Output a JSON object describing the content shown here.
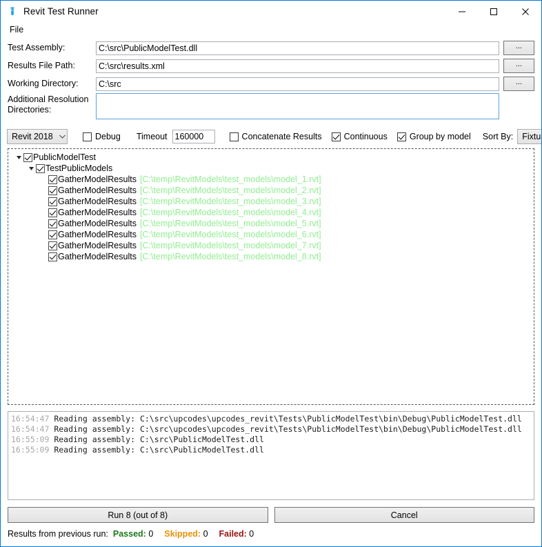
{
  "window": {
    "title": "Revit Test Runner",
    "icon": "test-tube-icon",
    "minimize_label": "Minimize",
    "maximize_label": "Maximize",
    "close_label": "Close",
    "accent_color": "#0078d7"
  },
  "menu": {
    "items": [
      {
        "label": "File"
      }
    ]
  },
  "form": {
    "rows": [
      {
        "label": "Test Assembly:",
        "value": "C:\\src\\PublicModelTest.dll",
        "placeholder": "",
        "browse_label": "...",
        "name": "test-assembly"
      },
      {
        "label": "Results File Path:",
        "value": "C:\\src\\results.xml",
        "placeholder": "",
        "browse_label": "...",
        "name": "results-file-path"
      },
      {
        "label": "Working Directory:",
        "value": "C:\\src",
        "placeholder": "",
        "browse_label": "...",
        "name": "working-directory"
      }
    ],
    "additional": {
      "label_line1": "Additional Resolution",
      "label_line2": "Directories:",
      "value": "",
      "placeholder": ""
    }
  },
  "options": {
    "revit_version": {
      "label": "Revit 2018",
      "arrow": "chevron-down"
    },
    "debug": {
      "label": "Debug",
      "checked": false
    },
    "timeout": {
      "label": "Timeout",
      "value": "160000",
      "placeholder": ""
    },
    "concatenate": {
      "label": "Concatenate Results",
      "checked": false
    },
    "continuous": {
      "label": "Continuous",
      "checked": true
    },
    "group_by_model": {
      "label": "Group by model",
      "checked": true
    },
    "sort_by": {
      "label": "Sort By:",
      "value": "Fixture",
      "arrow": "chevron-down"
    }
  },
  "tree": {
    "path_color": "#90ee90",
    "nodes": [
      {
        "depth": 0,
        "expander": "expanded",
        "checked": true,
        "name": "PublicModelTest",
        "path": ""
      },
      {
        "depth": 1,
        "expander": "expanded",
        "checked": true,
        "name": "TestPublicModels",
        "path": ""
      },
      {
        "depth": 2,
        "expander": "none",
        "checked": true,
        "name": "GatherModelResults",
        "path": "[C:\\temp\\RevitModels\\test_models\\model_1.rvt]"
      },
      {
        "depth": 2,
        "expander": "none",
        "checked": true,
        "name": "GatherModelResults",
        "path": "[C:\\temp\\RevitModels\\test_models\\model_2.rvt]"
      },
      {
        "depth": 2,
        "expander": "none",
        "checked": true,
        "name": "GatherModelResults",
        "path": "[C:\\temp\\RevitModels\\test_models\\model_3.rvt]"
      },
      {
        "depth": 2,
        "expander": "none",
        "checked": true,
        "name": "GatherModelResults",
        "path": "[C:\\temp\\RevitModels\\test_models\\model_4.rvt]"
      },
      {
        "depth": 2,
        "expander": "none",
        "checked": true,
        "name": "GatherModelResults",
        "path": "[C:\\temp\\RevitModels\\test_models\\model_5.rvt]"
      },
      {
        "depth": 2,
        "expander": "none",
        "checked": true,
        "name": "GatherModelResults",
        "path": "[C:\\temp\\RevitModels\\test_models\\model_6.rvt]"
      },
      {
        "depth": 2,
        "expander": "none",
        "checked": true,
        "name": "GatherModelResults",
        "path": "[C:\\temp\\RevitModels\\test_models\\model_7.rvt]"
      },
      {
        "depth": 2,
        "expander": "none",
        "checked": true,
        "name": "GatherModelResults",
        "path": "[C:\\temp\\RevitModels\\test_models\\model_8.rvt]"
      }
    ]
  },
  "log": {
    "lines": [
      {
        "time": "16:54:47",
        "text": "Reading assembly: C:\\src\\upcodes\\upcodes_revit\\Tests\\PublicModelTest\\bin\\Debug\\PublicModelTest.dll"
      },
      {
        "time": "16:54:47",
        "text": "Reading assembly: C:\\src\\upcodes\\upcodes_revit\\Tests\\PublicModelTest\\bin\\Debug\\PublicModelTest.dll"
      },
      {
        "time": "16:55:09",
        "text": "Reading assembly: C:\\src\\PublicModelTest.dll"
      },
      {
        "time": "16:55:09",
        "text": "Reading assembly: C:\\src\\PublicModelTest.dll"
      }
    ]
  },
  "buttons": {
    "run": "Run 8 (out of 8)",
    "cancel": "Cancel"
  },
  "status": {
    "prefix": "Results from previous run:",
    "passed_label": "Passed:",
    "passed_value": "0",
    "skipped_label": "Skipped:",
    "skipped_value": "0",
    "failed_label": "Failed:",
    "failed_value": "0",
    "passed_color": "#1a7a1a",
    "skipped_color": "#e8920a",
    "failed_color": "#9b1111"
  }
}
